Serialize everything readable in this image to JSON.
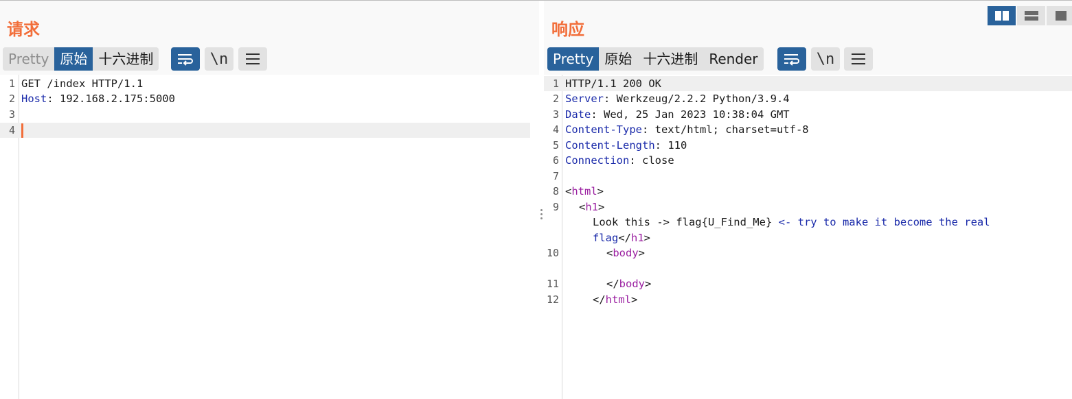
{
  "request": {
    "title": "请求",
    "tabs": [
      {
        "label": "Pretty",
        "state": "muted"
      },
      {
        "label": "原始",
        "state": "active"
      },
      {
        "label": "十六进制",
        "state": "normal"
      }
    ],
    "newline_glyph": "\\n",
    "lines": [
      {
        "num": "1",
        "key": "",
        "text": "GET /index HTTP/1.1"
      },
      {
        "num": "2",
        "key": "Host",
        "text": ": 192.168.2.175:5000"
      },
      {
        "num": "3",
        "key": "",
        "text": ""
      },
      {
        "num": "4",
        "key": "",
        "text": ""
      }
    ]
  },
  "response": {
    "title": "响应",
    "tabs": [
      {
        "label": "Pretty",
        "state": "active"
      },
      {
        "label": "原始",
        "state": "normal"
      },
      {
        "label": "十六进制",
        "state": "normal"
      },
      {
        "label": "Render",
        "state": "normal"
      }
    ],
    "newline_glyph": "\\n",
    "lines": {
      "l1": {
        "num": "1",
        "text": "HTTP/1.1 200 OK"
      },
      "l2": {
        "num": "2",
        "key": "Server",
        "val": ": Werkzeug/2.2.2 Python/3.9.4"
      },
      "l3": {
        "num": "3",
        "key": "Date",
        "val": ": Wed, 25 Jan 2023 10:38:04 GMT"
      },
      "l4": {
        "num": "4",
        "key": "Content-Type",
        "val": ": text/html; charset=utf-8"
      },
      "l5": {
        "num": "5",
        "key": "Content-Length",
        "val": ": 110"
      },
      "l6": {
        "num": "6",
        "key": "Connection",
        "val": ": close"
      },
      "l7": {
        "num": "7"
      },
      "l8": {
        "num": "8",
        "open": "<",
        "tag": "html",
        "close": ">"
      },
      "l9": {
        "num": "9",
        "open": "<",
        "tag": "h1",
        "close": ">"
      },
      "l9a": {
        "text": "Look this -> flag{U_Find_Me} ",
        "comment": "<- try to make it become the real"
      },
      "l9b": {
        "comment": "flag",
        "open": "</",
        "tag": "h1",
        "close": ">"
      },
      "l10": {
        "num": "10",
        "open": "<",
        "tag": "body",
        "close": ">"
      },
      "l11": {
        "num": "11",
        "open": "</",
        "tag": "body",
        "close": ">"
      },
      "l12": {
        "num": "12",
        "open": "</",
        "tag": "html",
        "close": ">"
      }
    }
  },
  "colors": {
    "accent_orange": "#f26e3a",
    "active_blue": "#29629b",
    "header_key": "#1b2baa",
    "html_tag": "#9a1ea0"
  },
  "icons": {
    "wrap": "wrap-lines-icon",
    "newline": "show-newlines-icon",
    "menu": "menu-icon",
    "layout": [
      "layout-side-by-side-icon",
      "layout-stacked-icon",
      "layout-single-icon"
    ]
  }
}
